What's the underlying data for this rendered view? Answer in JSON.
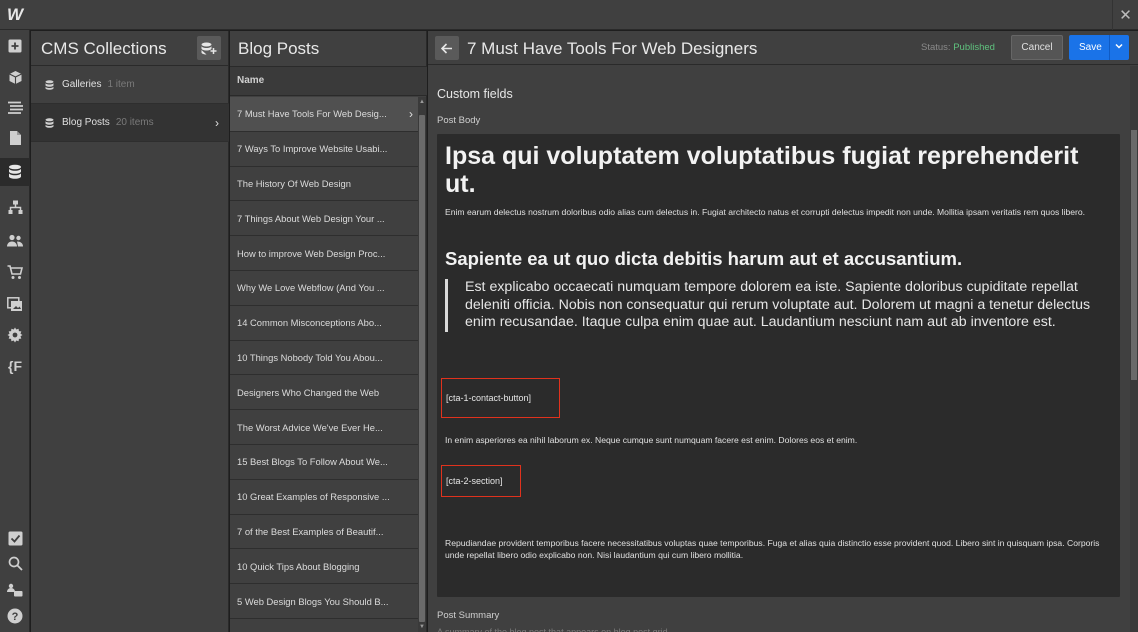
{
  "app": {
    "logo": "W",
    "close_icon": "close-icon"
  },
  "rail": {
    "icons": [
      "add-icon",
      "box-icon",
      "navigator-icon",
      "pages-icon",
      "cms-database-icon",
      "logic-flow-icon",
      "users-icon",
      "ecommerce-cart-icon",
      "assets-icon",
      "settings-gear-icon",
      "custom-code-icon",
      "checklist-icon",
      "search-icon",
      "collaborators-icon",
      "help-icon"
    ],
    "code_label": "{F"
  },
  "collections": {
    "title": "CMS Collections",
    "items": [
      {
        "label": "Galleries",
        "count": "1 item"
      },
      {
        "label": "Blog Posts",
        "count": "20 items"
      }
    ]
  },
  "posts": {
    "title": "Blog Posts",
    "column": "Name",
    "items": [
      "7 Must Have Tools For Web Desig...",
      "7 Ways To Improve Website Usabi...",
      "The History Of Web Design",
      "7 Things About Web Design Your ...",
      "How to improve Web Design Proc...",
      "Why We Love Webflow (And You ...",
      "14 Common Misconceptions Abo...",
      "10 Things Nobody Told You Abou...",
      "Designers Who Changed the Web",
      "The Worst Advice We've Ever He...",
      "15 Best Blogs To Follow About We...",
      "10 Great Examples of Responsive ...",
      "7 of the Best Examples of Beautif...",
      "10 Quick Tips About Blogging",
      "5 Web Design Blogs You Should B..."
    ]
  },
  "editor": {
    "title": "7 Must Have Tools For Web Designers",
    "status_label": "Status:",
    "status_value": "Published",
    "cancel_label": "Cancel",
    "save_label": "Save",
    "section": "Custom fields",
    "field_body": "Post Body",
    "heading1": "Ipsa qui voluptatem voluptatibus fugiat reprehenderit ut.",
    "para1": "Enim earum delectus nostrum doloribus odio alias cum delectus in. Fugiat architecto natus et corrupti delectus impedit non unde. Mollitia ipsam veritatis rem quos libero.",
    "heading2": "Sapiente ea ut quo dicta debitis harum aut et accusantium.",
    "quote": "Est explicabo occaecati numquam tempore dolorem ea iste. Sapiente doloribus cupiditate repellat deleniti officia. Nobis non consequatur qui rerum voluptate aut. Dolorem ut magni a tenetur delectus enim recusandae. Itaque culpa enim quae aut. Laudantium nesciunt nam aut ab inventore est.",
    "embed1": "[cta-1-contact-button]",
    "para2": "In enim asperiores ea nihil laborum ex. Neque cumque sunt numquam facere est enim. Dolores eos et enim.",
    "embed2": "[cta-2-section]",
    "para3": "Repudiandae provident temporibus facere necessitatibus voluptas quae temporibus. Fuga et alias quia distinctio esse provident quod. Libero sint in quisquam ipsa. Corporis unde repellat libero odio explicabo non. Nisi laudantium qui cum libero mollitia.",
    "field_summary": "Post Summary",
    "summary_hint": "A summary of the blog post that appears on blog post grid"
  },
  "colors": {
    "accent": "#1a73e8",
    "published": "#5fc27e",
    "embed_border": "#e0321d"
  }
}
